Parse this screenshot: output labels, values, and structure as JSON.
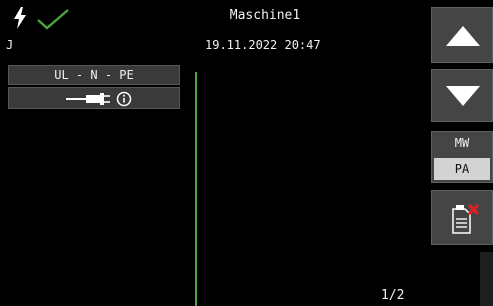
{
  "header": {
    "title": "Maschine1",
    "datetime": "19.11.2022 20:47",
    "left_text": "J"
  },
  "status": {
    "icons": [
      "lightning-icon",
      "check-icon"
    ],
    "check_color": "#4aa63a"
  },
  "test": {
    "label": "UL - N - PE",
    "plug_icon": "plug-info-icon"
  },
  "controls": {
    "up_icon": "arrow-up-icon",
    "down_icon": "arrow-down-icon",
    "mode_label": "MW",
    "mode_selected": "PA",
    "clear_icon": "clear-document-icon"
  },
  "pagination": {
    "text": "1/2"
  }
}
